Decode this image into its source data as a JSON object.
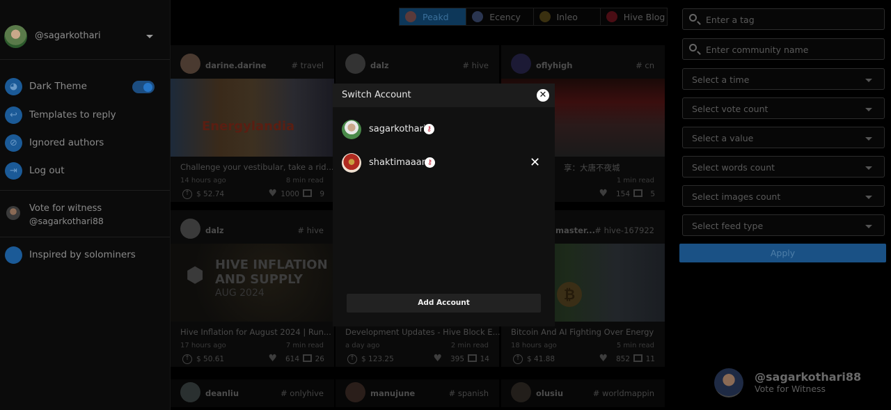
{
  "sidebar": {
    "username": "@sagarkothari",
    "menu": [
      {
        "label": "Dark Theme",
        "icon": "palette-icon",
        "toggle": true,
        "toggle_on": true
      },
      {
        "label": "Templates to reply",
        "icon": "reply-icon"
      },
      {
        "label": "Ignored authors",
        "icon": "ignored-user-icon"
      },
      {
        "label": "Log out",
        "icon": "logout-icon"
      }
    ],
    "witness": {
      "line1": "Vote for witness",
      "line2": "@sagarkothari88"
    },
    "inspired": {
      "label": "Inspired by solominers"
    }
  },
  "platform_tabs": [
    {
      "label": "Peakd",
      "active": true
    },
    {
      "label": "Ecency",
      "active": false
    },
    {
      "label": "Inleo",
      "active": false
    },
    {
      "label": "Hive Blog",
      "active": false
    }
  ],
  "feed": [
    {
      "author": "darine.darine",
      "tag": "# travel",
      "image_text": "Energylandia",
      "title": "Challenge your vestibular, take a rid...",
      "time": "14 hours ago",
      "read": "8 min read",
      "payout": "$ 52.74",
      "votes": "1000",
      "comments": "9"
    },
    {
      "author": "dalz",
      "tag": "# hive",
      "image_text": "",
      "title": "Development Updates - Hive Block E...",
      "time": "a day ago",
      "read": "2 min read",
      "payout": "$ 123.25",
      "votes": "395",
      "comments": "14"
    },
    {
      "author": "oflyhigh",
      "tag": "# cn",
      "image_text": "",
      "title": "享：大唐不夜城",
      "time": "",
      "read": "1 min read",
      "payout": "",
      "votes": "154",
      "comments": "5"
    },
    {
      "author": "dalz",
      "tag": "# hive",
      "image_text": "HIVE INFLATION AND SUPPLY",
      "image_subtext": "AUG 2024",
      "title": "Hive Inflation for August 2024 | Run...",
      "time": "17 hours ago",
      "read": "7 min read",
      "payout": "$ 50.61",
      "votes": "614",
      "comments": "26"
    },
    {
      "author": "master...",
      "tag": "# hive-167922",
      "image_text": "",
      "title": "Bitcoin And AI Fighting Over Energy",
      "time": "18 hours ago",
      "read": "5 min read",
      "payout": "$ 41.88",
      "votes": "852",
      "comments": "11"
    },
    {
      "author": "deanliu",
      "tag": "# onlyhive"
    },
    {
      "author": "manujune",
      "tag": "# spanish"
    },
    {
      "author": "olusiu",
      "tag": "# worldmappin"
    }
  ],
  "filters": {
    "tag_placeholder": "Enter a tag",
    "community_placeholder": "Enter community name",
    "selects": [
      "Select a time",
      "Select vote count",
      "Select a value",
      "Select words count",
      "Select images count",
      "Select feed type"
    ],
    "apply_label": "Apply"
  },
  "witness_float": {
    "name": "@sagarkothari88",
    "sub": "Vote for Witness"
  },
  "modal": {
    "title": "Switch Account",
    "accounts": [
      {
        "name": "sagarkothari",
        "removable": false
      },
      {
        "name": "shaktimaaan",
        "removable": true
      }
    ],
    "add_label": "Add Account",
    "close_glyph": "✕",
    "remove_glyph": "✕"
  },
  "colors": {
    "accent": "#1b5a97",
    "modal_bg": "#111111",
    "modal_header": "#1c1c1c"
  }
}
